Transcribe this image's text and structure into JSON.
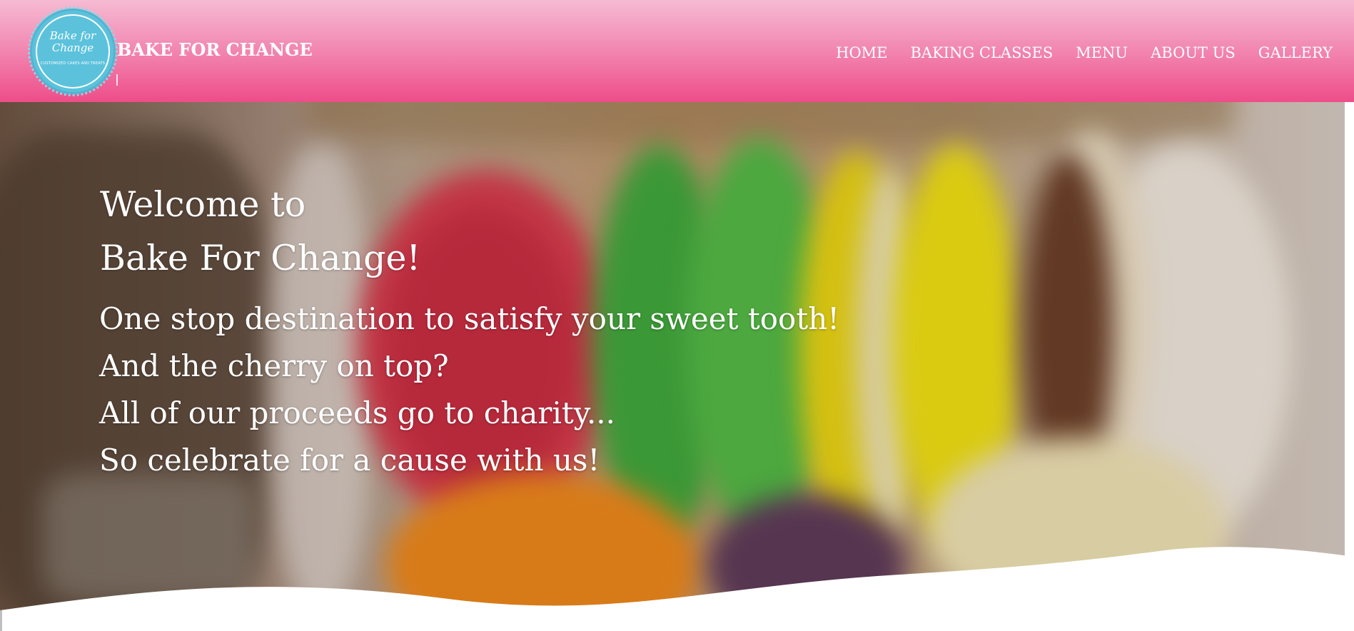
{
  "header": {
    "logo": {
      "script_line1": "Bake for",
      "script_line2": "Change",
      "tagline": "CUSTOMIZED CAKES AND TREATS"
    },
    "brand_name": "BAKE FOR CHANGE",
    "nav": [
      {
        "label": "HOME"
      },
      {
        "label": "BAKING CLASSES"
      },
      {
        "label": "MENU"
      },
      {
        "label": "ABOUT US"
      },
      {
        "label": "GALLERY"
      }
    ]
  },
  "hero": {
    "welcome_line1": "Welcome to",
    "welcome_line2": "Bake For Change!",
    "tagline_lines": [
      "One stop destination to satisfy your sweet tooth!",
      "And the cherry on top?",
      "All of our proceeds go to charity...",
      "So celebrate for a cause with us!"
    ]
  },
  "colors": {
    "header_gradient_top": "#f6bbd3",
    "header_gradient_bottom": "#ee4d89",
    "logo_badge": "#5cc2dc",
    "text": "#ffffff"
  }
}
